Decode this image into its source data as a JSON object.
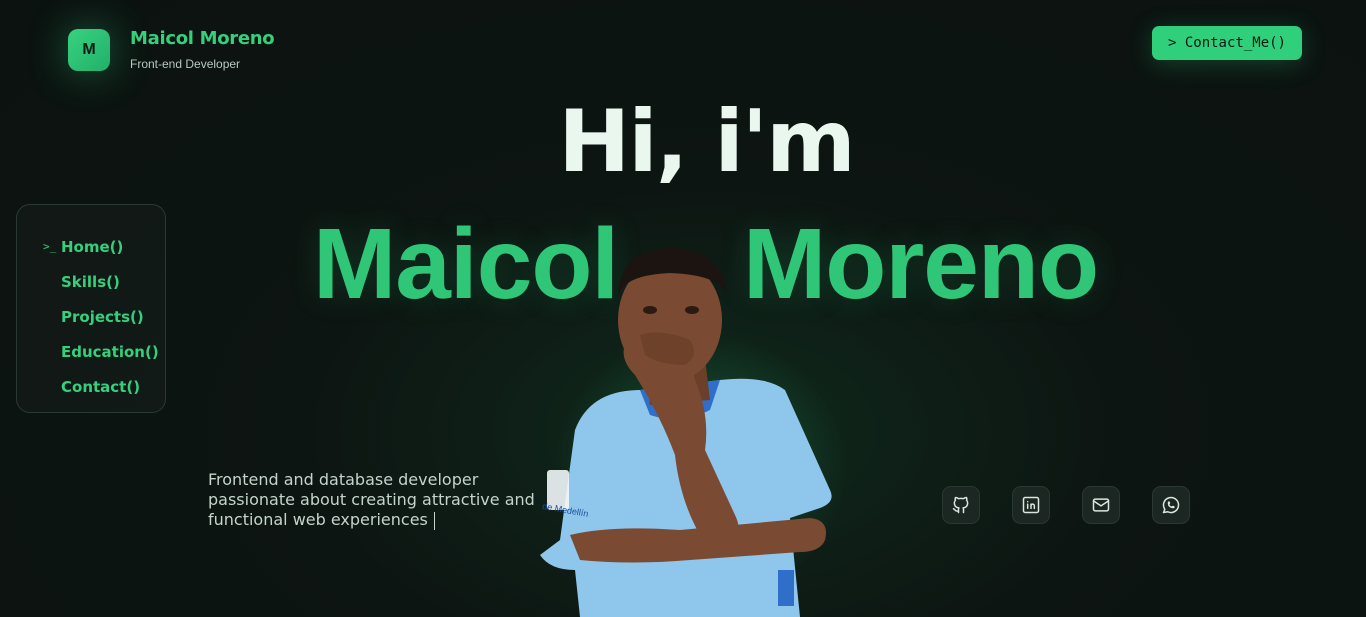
{
  "brand": {
    "logo_letter": "M",
    "name": "Maicol Moreno",
    "role": "Front-end Developer"
  },
  "header": {
    "contact_button": "> Contact_Me()"
  },
  "nav": {
    "prompt": ">_",
    "items": [
      {
        "label": "Home()",
        "active": true
      },
      {
        "label": "Skills()",
        "active": false
      },
      {
        "label": "Projects()",
        "active": false
      },
      {
        "label": "Education()",
        "active": false
      },
      {
        "label": "Contact()",
        "active": false
      }
    ]
  },
  "hero": {
    "greeting": "Hi, i'm",
    "first_name": "Maicol",
    "last_name": "Moreno",
    "tagline": "Frontend and database developer passionate about creating attractive and functional web experiences",
    "jersey_text": "de Medellín"
  },
  "socials": [
    {
      "icon": "github-icon"
    },
    {
      "icon": "linkedin-icon"
    },
    {
      "icon": "mail-icon"
    },
    {
      "icon": "whatsapp-icon"
    }
  ],
  "colors": {
    "accent": "#2fc777",
    "background": "#0b1210",
    "shirt": "#8fc6ec",
    "skin": "#7a4b32"
  }
}
